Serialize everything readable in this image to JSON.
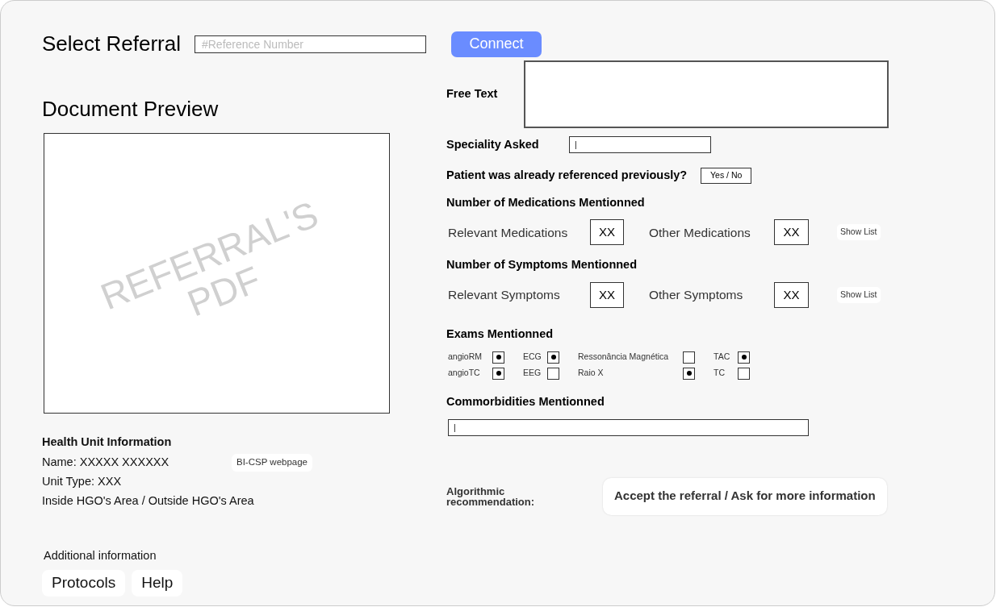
{
  "header": {
    "title": "Select Referral",
    "reference_field": {
      "placeholder": "#Reference Number"
    },
    "connect_button": "Connect"
  },
  "preview": {
    "title": "Document Preview",
    "watermark": [
      "REFERRAL'S",
      "PDF"
    ]
  },
  "health_unit": {
    "title": "Health Unit Information",
    "name": "Name: XXXXX XXXXXX",
    "webpage_button": "BI-CSP webpage",
    "unit_type": "Unit Type: XXX",
    "area": "Inside HGO's Area / Outside HGO's Area"
  },
  "additional": {
    "title": "Additional information",
    "buttons": [
      "Protocols",
      "Help"
    ]
  },
  "free_text": {
    "label": "Free Text"
  },
  "speciality": {
    "label": "Speciality Asked",
    "value": "|"
  },
  "previous": {
    "label": "Patient was already referenced previously?",
    "button": "Yes / No"
  },
  "medications": {
    "title": "Number of Medications Mentionned",
    "relevant_label": "Relevant Medications",
    "relevant_value": "XX",
    "other_label": "Other Medications",
    "other_value": "XX",
    "button": "Show List"
  },
  "symptoms": {
    "title": "Number of Symptoms Mentionned",
    "relevant_label": "Relevant Symptoms",
    "relevant_value": "XX",
    "other_label": "Other Symptoms",
    "other_value": "XX",
    "button": "Show List"
  },
  "exams": {
    "title": "Exams Mentionned",
    "items": [
      {
        "label": "angioRM",
        "checked": true
      },
      {
        "label": "angioTC",
        "checked": true
      },
      {
        "label": "ECG",
        "checked": true
      },
      {
        "label": "EEG",
        "checked": false
      },
      {
        "label": "Ressonância Magnética",
        "checked": false
      },
      {
        "label": "Raio X",
        "checked": true
      },
      {
        "label": "TAC",
        "checked": true
      },
      {
        "label": "TC",
        "checked": false
      }
    ]
  },
  "comorbidities": {
    "title": "Commorbidities Mentionned",
    "value": "|"
  },
  "recommendation": {
    "label": "Algorithmic recommendation:",
    "value": "Accept the referral / Ask for more information"
  }
}
